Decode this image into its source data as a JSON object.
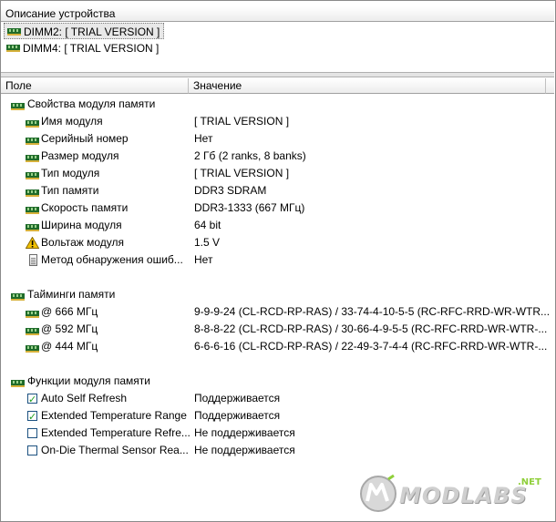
{
  "top_pane": {
    "header": "Описание устройства",
    "devices": [
      {
        "label": "DIMM2: [ TRIAL VERSION ]",
        "selected": true
      },
      {
        "label": "DIMM4: [ TRIAL VERSION ]",
        "selected": false
      }
    ]
  },
  "grid": {
    "col_field": "Поле",
    "col_value": "Значение",
    "groups": {
      "props": {
        "title": "Свойства модуля памяти",
        "rows": [
          {
            "label": "Имя модуля",
            "value": "[ TRIAL VERSION ]",
            "icon": "memory-icon"
          },
          {
            "label": "Серийный номер",
            "value": "Нет",
            "icon": "memory-icon"
          },
          {
            "label": "Размер модуля",
            "value": "2 Гб (2 ranks, 8 banks)",
            "icon": "memory-icon"
          },
          {
            "label": "Тип модуля",
            "value": "[ TRIAL VERSION ]",
            "icon": "memory-icon"
          },
          {
            "label": "Тип памяти",
            "value": "DDR3 SDRAM",
            "icon": "memory-icon"
          },
          {
            "label": "Скорость памяти",
            "value": "DDR3-1333 (667 МГц)",
            "icon": "memory-icon"
          },
          {
            "label": "Ширина модуля",
            "value": "64 bit",
            "icon": "memory-icon"
          },
          {
            "label": "Вольтаж модуля",
            "value": "1.5 V",
            "icon": "warning-icon"
          },
          {
            "label": "Метод обнаружения ошиб...",
            "value": "Нет",
            "icon": "document-icon"
          }
        ]
      },
      "timings": {
        "title": "Тайминги памяти",
        "rows": [
          {
            "label": "@ 666 МГц",
            "value": "9-9-9-24  (CL-RCD-RP-RAS) / 33-74-4-10-5-5  (RC-RFC-RRD-WR-WTR..."
          },
          {
            "label": "@ 592 МГц",
            "value": "8-8-8-22  (CL-RCD-RP-RAS) / 30-66-4-9-5-5  (RC-RFC-RRD-WR-WTR-..."
          },
          {
            "label": "@ 444 МГц",
            "value": "6-6-6-16  (CL-RCD-RP-RAS) / 22-49-3-7-4-4  (RC-RFC-RRD-WR-WTR-..."
          }
        ]
      },
      "features": {
        "title": "Функции модуля памяти",
        "rows": [
          {
            "label": "Auto Self Refresh",
            "value": "Поддерживается",
            "checked": true
          },
          {
            "label": "Extended Temperature Range",
            "value": "Поддерживается",
            "checked": true
          },
          {
            "label": "Extended Temperature Refre...",
            "value": "Не поддерживается",
            "checked": false
          },
          {
            "label": "On-Die Thermal Sensor Rea...",
            "value": "Не поддерживается",
            "checked": false
          }
        ]
      }
    }
  },
  "watermark": {
    "text": "MODLABS",
    "suffix": ".NET"
  },
  "colors": {
    "memory_chip": "#1f6b2a",
    "memory_pins": "#d6b13b",
    "check": "#21a121",
    "warning": "#f2c200"
  }
}
